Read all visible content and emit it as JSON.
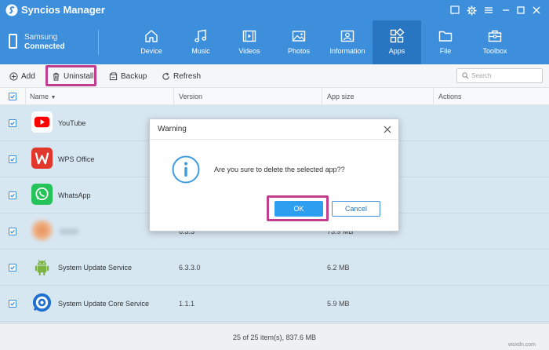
{
  "app": {
    "title": "Syncios Manager"
  },
  "device": {
    "name": "Samsung",
    "status": "Connected"
  },
  "nav": [
    {
      "label": "Device",
      "icon": "home-icon"
    },
    {
      "label": "Music",
      "icon": "music-note-icon"
    },
    {
      "label": "Videos",
      "icon": "film-icon"
    },
    {
      "label": "Photos",
      "icon": "image-icon"
    },
    {
      "label": "Information",
      "icon": "contact-card-icon"
    },
    {
      "label": "Apps",
      "icon": "apps-grid-icon",
      "active": true
    },
    {
      "label": "File",
      "icon": "folder-icon"
    },
    {
      "label": "Toolbox",
      "icon": "toolbox-icon"
    }
  ],
  "toolbar": {
    "add_label": "Add",
    "uninstall_label": "Uninstall",
    "backup_label": "Backup",
    "refresh_label": "Refresh",
    "search_placeholder": "Search"
  },
  "table": {
    "columns": [
      "Name",
      "Version",
      "App size",
      "Actions"
    ],
    "rows": [
      {
        "name": "YouTube",
        "version": "",
        "size": "",
        "checked": true,
        "icon": "youtube-icon"
      },
      {
        "name": "WPS Office",
        "version": "",
        "size": "",
        "checked": true,
        "icon": "wps-office-icon"
      },
      {
        "name": "WhatsApp",
        "version": "",
        "size": "",
        "checked": true,
        "icon": "whatsapp-icon"
      },
      {
        "name": "",
        "version": "6.3.3",
        "size": "73.9 MB",
        "checked": true,
        "icon": "blurred-app-icon"
      },
      {
        "name": "System Update Service",
        "version": "6.3.3.0",
        "size": "6.2 MB",
        "checked": true,
        "icon": "android-icon"
      },
      {
        "name": "System Update Core Service",
        "version": "1.1.1",
        "size": "5.9 MB",
        "checked": true,
        "icon": "update-core-icon"
      }
    ]
  },
  "dialog": {
    "title": "Warning",
    "message": "Are you sure to delete the selected app??",
    "ok_label": "OK",
    "cancel_label": "Cancel"
  },
  "footer": {
    "summary": "25 of 25 item(s), 837.6 MB",
    "watermark": "wsxdn.com"
  },
  "colors": {
    "header_blue": "#3d8fdc",
    "active_tab": "#2876c2",
    "highlight": "#c13e8e",
    "ok_button": "#2e9ff0",
    "selected_row": "#d7e7f2"
  }
}
